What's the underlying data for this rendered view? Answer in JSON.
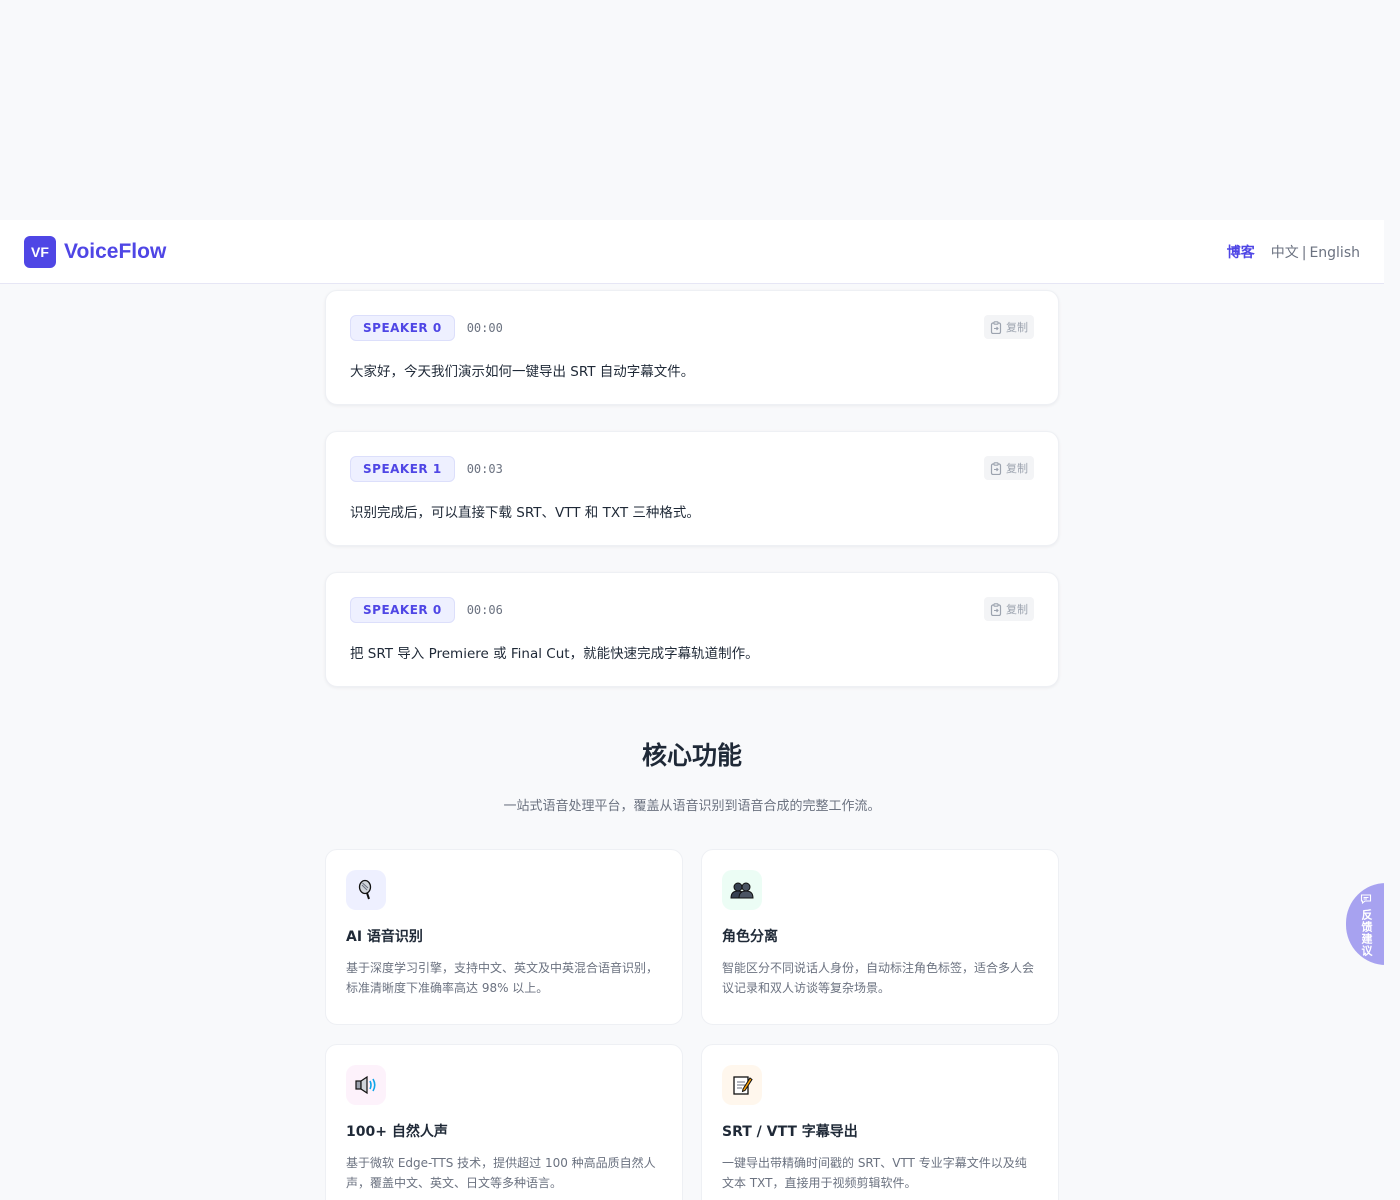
{
  "nav": {
    "logo": "VF",
    "brand": "VoiceFlow",
    "blog": "博客",
    "lang_zh": "中文",
    "lang_sep": "|",
    "lang_en": "English"
  },
  "transcripts": [
    {
      "speaker": "SPEAKER 0",
      "time": "00:00",
      "copy": "复制",
      "text": "大家好，今天我们演示如何一键导出 SRT 自动字幕文件。"
    },
    {
      "speaker": "SPEAKER 1",
      "time": "00:03",
      "copy": "复制",
      "text": "识别完成后，可以直接下载 SRT、VTT 和 TXT 三种格式。"
    },
    {
      "speaker": "SPEAKER 0",
      "time": "00:06",
      "copy": "复制",
      "text": "把 SRT 导入 Premiere 或 Final Cut，就能快速完成字幕轨道制作。"
    }
  ],
  "features_section": {
    "title": "核心功能",
    "subtitle": "一站式语音处理平台，覆盖从语音识别到语音合成的完整工作流。",
    "items": [
      {
        "icon": "microphone-icon",
        "icon_bg": "#eef0ff",
        "title": "AI 语音识别",
        "desc": "基于深度学习引擎，支持中文、英文及中英混合语音识别，标准清晰度下准确率高达 98% 以上。"
      },
      {
        "icon": "speakers-icon",
        "icon_bg": "#ecfdf5",
        "title": "角色分离",
        "desc": "智能区分不同说话人身份，自动标注角色标签，适合多人会议记录和双人访谈等复杂场景。"
      },
      {
        "icon": "speaker-volume-icon",
        "icon_bg": "#fdf2fb",
        "title": "100+ 自然人声",
        "desc": "基于微软 Edge-TTS 技术，提供超过 100 种高品质自然人声，覆盖中文、英文、日文等多种语言。"
      },
      {
        "icon": "memo-icon",
        "icon_bg": "#fff7ed",
        "title": "SRT / VTT 字幕导出",
        "desc": "一键导出带精确时间戳的 SRT、VTT 专业字幕文件以及纯文本 TXT，直接用于视频剪辑软件。"
      }
    ]
  },
  "feedback": {
    "label": "反馈建议"
  }
}
